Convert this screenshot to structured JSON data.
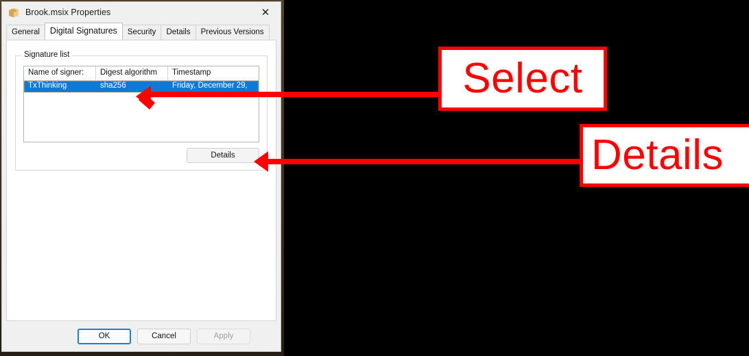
{
  "window": {
    "title": "Brook.msix Properties",
    "icon": "package-icon",
    "close_label": "✕"
  },
  "tabs": [
    {
      "label": "General",
      "active": false
    },
    {
      "label": "Digital Signatures",
      "active": true
    },
    {
      "label": "Security",
      "active": false
    },
    {
      "label": "Details",
      "active": false
    },
    {
      "label": "Previous Versions",
      "active": false
    }
  ],
  "signature_group": {
    "label": "Signature list",
    "columns": [
      "Name of signer:",
      "Digest algorithm",
      "Timestamp"
    ],
    "rows": [
      {
        "name_of_signer": "TxThinking",
        "digest_algorithm": "sha256",
        "timestamp": "Friday, December 29,",
        "selected": true
      }
    ],
    "details_button": "Details"
  },
  "footer": {
    "ok": "OK",
    "cancel": "Cancel",
    "apply": "Apply"
  },
  "annotations": [
    {
      "id": "select",
      "text": "Select"
    },
    {
      "id": "details",
      "text": "Details"
    }
  ],
  "colors": {
    "annotation_red": "#ff0000",
    "selection_blue": "#0d7ada",
    "default_button_border": "#1a7fd4",
    "dialog_bg": "#f0f0f0",
    "page_bg": "#000000"
  }
}
